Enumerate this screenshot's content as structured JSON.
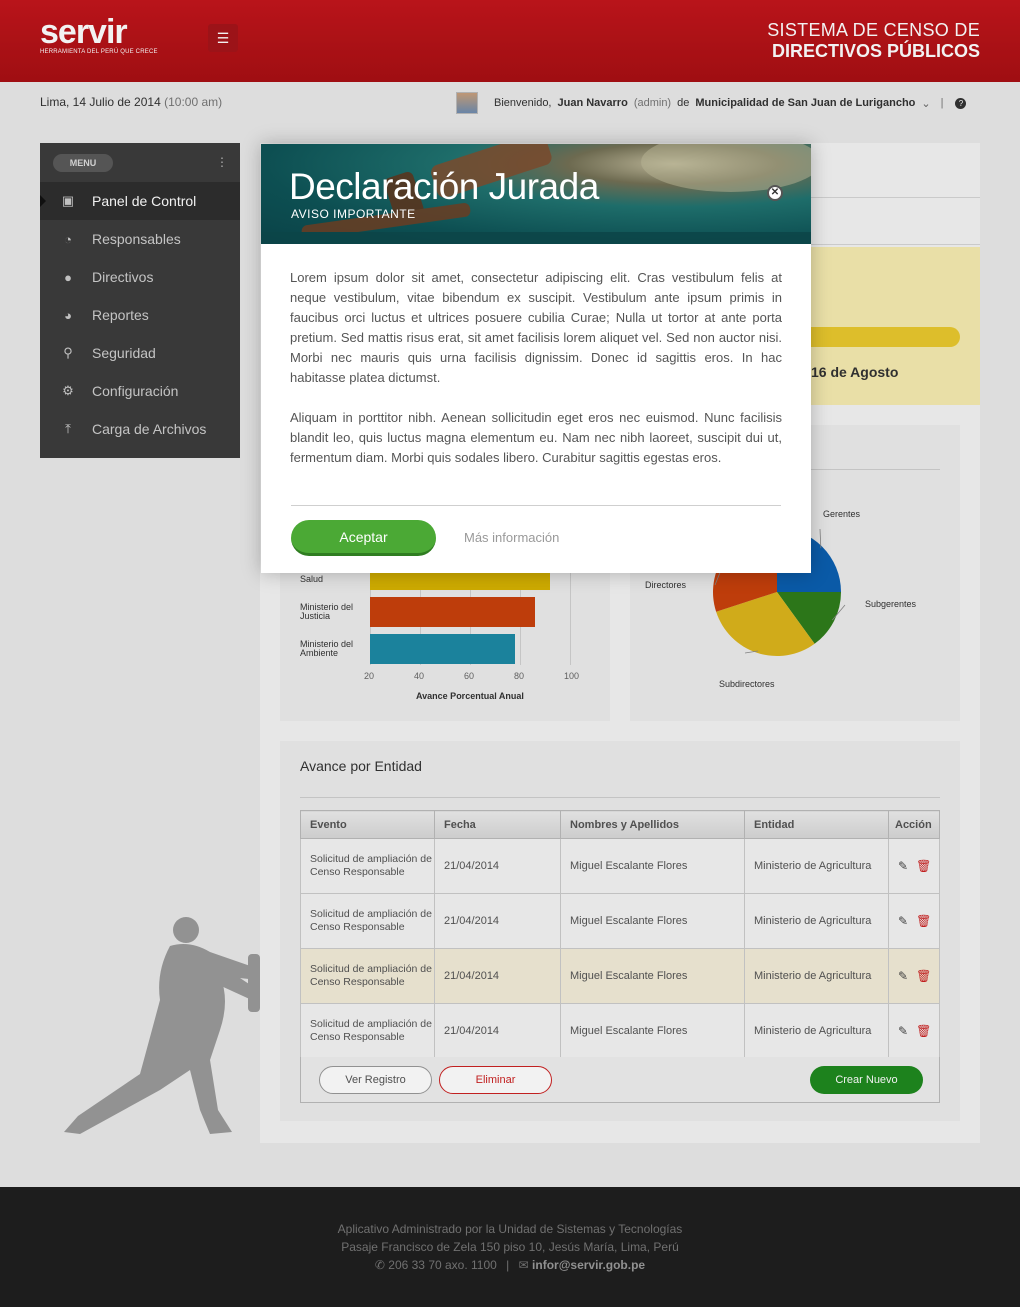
{
  "header": {
    "logo_word": "servir",
    "logo_tagline": "HERRAMIENTA DEL PERÚ QUE CRECE",
    "menu_icon": "hamburger-icon",
    "system_line1": "SISTEMA DE CENSO  DE",
    "system_line2": "DIRECTIVOS PÚBLICOS"
  },
  "infobar": {
    "date": "Lima, 14 Julio de 2014",
    "time": "(10:00 am)",
    "welcome": "Bienvenido,",
    "user_name": "Juan Navarro",
    "role": "(admin)",
    "de": "de",
    "entity": "Municipalidad de San Juan de Lurigancho",
    "separator": "|"
  },
  "sidebar": {
    "menu_label": "MENU",
    "items": [
      {
        "label": "Panel de Control",
        "icon": "monitor-icon",
        "active": true
      },
      {
        "label": "Responsables",
        "icon": "dashboard-icon"
      },
      {
        "label": "Directivos",
        "icon": "users-icon"
      },
      {
        "label": "Reportes",
        "icon": "pie-chart-icon"
      },
      {
        "label": "Seguridad",
        "icon": "key-icon"
      },
      {
        "label": "Configuración",
        "icon": "gears-icon"
      },
      {
        "label": "Carga de Archivos",
        "icon": "upload-icon"
      }
    ]
  },
  "highlight": {
    "text": "16 de Agosto"
  },
  "bar_chart": {
    "type": "bar",
    "categories": [
      "Salud",
      "Ministerio del Justicia",
      "Ministerio del Ambiente"
    ],
    "values": [
      92,
      86,
      78
    ],
    "colors": [
      "#d9b400",
      "#c9410c",
      "#1d8aa5"
    ],
    "ticks": [
      "20",
      "40",
      "60",
      "80",
      "100"
    ],
    "xlabel": "Avance Porcentual Anual",
    "xlim": [
      20,
      100
    ]
  },
  "pie_chart": {
    "type": "pie",
    "labels": [
      "Gerentes",
      "Subgerentes",
      "Subdirectores",
      "Directores"
    ],
    "values": [
      25,
      15,
      30,
      30
    ],
    "colors": [
      "#0b5fb0",
      "#2f7d1b",
      "#dcb51c",
      "#c9410c"
    ]
  },
  "table": {
    "title": "Avance por Entidad",
    "headers": [
      "Evento",
      "Fecha",
      "Nombres y Apellidos",
      "Entidad",
      "Acción"
    ],
    "rows": [
      {
        "evento": "Solicitud de ampliación de Censo Responsable",
        "fecha": "21/04/2014",
        "nombre": "Miguel Escalante Flores",
        "entidad": "Ministerio de Agricultura"
      },
      {
        "evento": "Solicitud de ampliación de Censo Responsable",
        "fecha": "21/04/2014",
        "nombre": "Miguel Escalante Flores",
        "entidad": "Ministerio de Agricultura"
      },
      {
        "evento": "Solicitud de ampliación de Censo Responsable",
        "fecha": "21/04/2014",
        "nombre": "Miguel Escalante Flores",
        "entidad": "Ministerio de Agricultura"
      },
      {
        "evento": "Solicitud de ampliación de Censo Responsable",
        "fecha": "21/04/2014",
        "nombre": "Miguel Escalante Flores",
        "entidad": "Ministerio de Agricultura"
      }
    ],
    "btn_ver": "Ver Registro",
    "btn_eliminar": "Eliminar",
    "btn_crear": "Crear Nuevo"
  },
  "footer": {
    "line1": "Aplicativo Administrado por la Unidad de Sistemas y Tecnologías",
    "line2": "Pasaje Francisco de Zela 150 piso 10, Jesús María, Lima, Perú",
    "phone": "206 33 70 axo. 1100",
    "email": "infor@servir.gob.pe"
  },
  "modal": {
    "title": "Declaración Jurada",
    "subtitle": "AVISO IMPORTANTE",
    "paragraph1": "Lorem ipsum dolor sit amet, consectetur adipiscing elit. Cras vestibulum felis at neque vestibulum, vitae bibendum ex suscipit. Vestibulum ante ipsum primis in faucibus orci luctus et ultrices posuere cubilia Curae; Nulla ut tortor at ante porta pretium. Sed mattis risus erat, sit amet facilisis lorem aliquet vel. Sed non auctor nisi. Morbi nec mauris quis urna facilisis dignissim. Donec id sagittis eros. In hac habitasse platea dictumst.",
    "paragraph2": "Aliquam in porttitor nibh. Aenean sollicitudin eget eros nec euismod. Nunc facilisis blandit leo, quis luctus magna elementum eu. Nam nec nibh laoreet, suscipit dui ut, fermentum diam. Morbi quis sodales libero. Curabitur sagittis egestas eros.",
    "accept": "Aceptar",
    "more": "Más información"
  }
}
